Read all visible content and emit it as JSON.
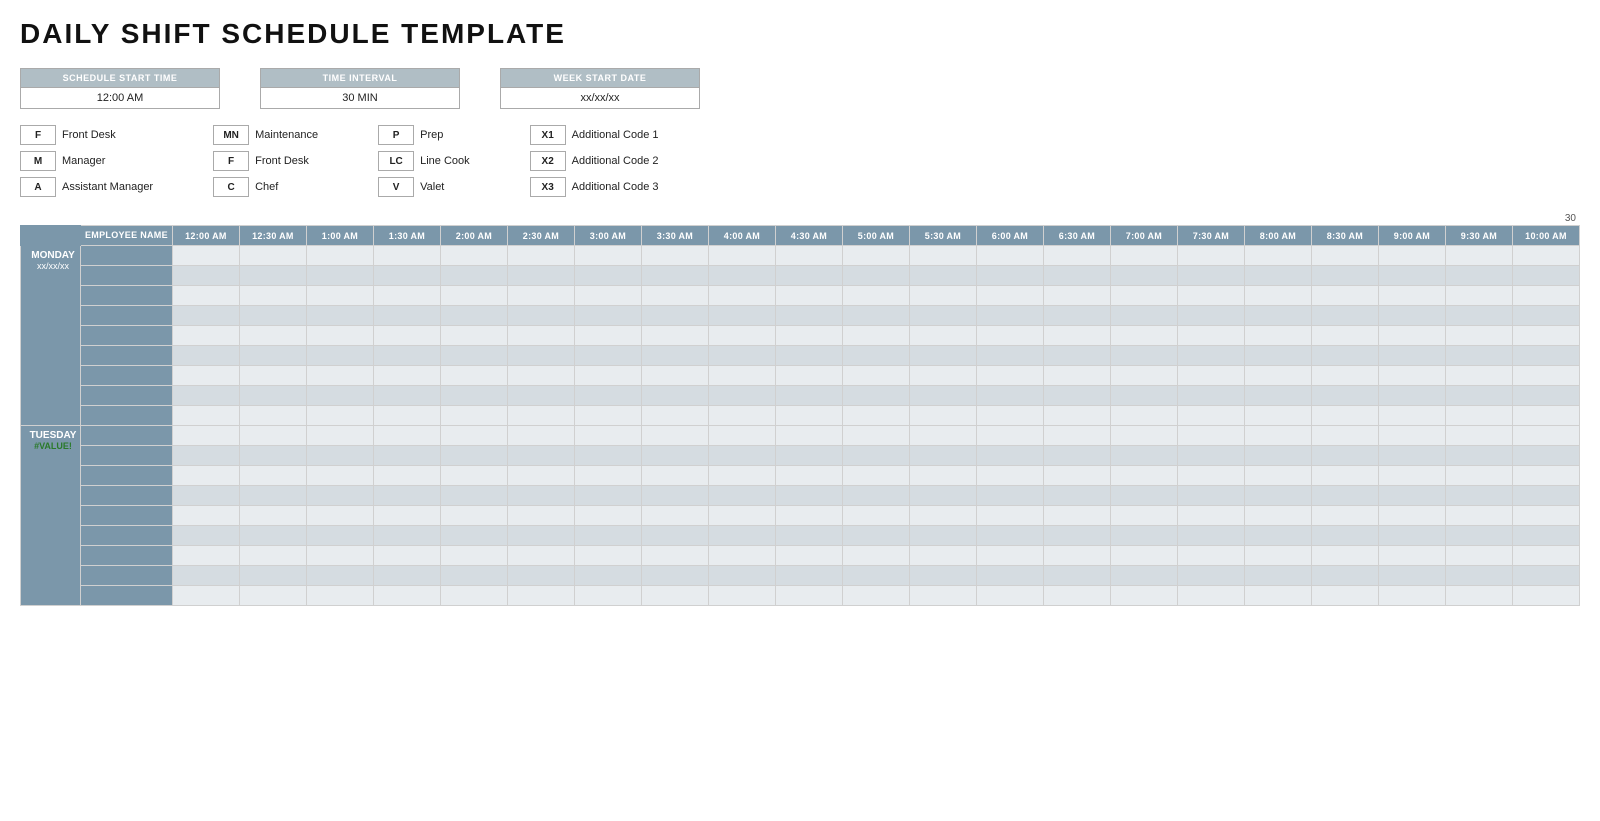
{
  "title": "DAILY SHIFT SCHEDULE TEMPLATE",
  "config": {
    "schedule_start_time_label": "SCHEDULE START TIME",
    "schedule_start_time_value": "12:00 AM",
    "time_interval_label": "TIME INTERVAL",
    "time_interval_value": "30 MIN",
    "week_start_date_label": "WEEK START DATE",
    "week_start_date_value": "xx/xx/xx"
  },
  "legend": [
    {
      "col": 1,
      "items": [
        {
          "code": "F",
          "name": "Front Desk"
        },
        {
          "code": "M",
          "name": "Manager"
        },
        {
          "code": "A",
          "name": "Assistant Manager"
        }
      ]
    },
    {
      "col": 2,
      "items": [
        {
          "code": "MN",
          "name": "Maintenance"
        },
        {
          "code": "F",
          "name": "Front Desk"
        },
        {
          "code": "C",
          "name": "Chef"
        }
      ]
    },
    {
      "col": 3,
      "items": [
        {
          "code": "P",
          "name": "Prep"
        },
        {
          "code": "LC",
          "name": "Line Cook"
        },
        {
          "code": "V",
          "name": "Valet"
        }
      ]
    },
    {
      "col": 4,
      "items": [
        {
          "code": "X1",
          "name": "Additional Code 1"
        },
        {
          "code": "X2",
          "name": "Additional Code 2"
        },
        {
          "code": "X3",
          "name": "Additional Code 3"
        }
      ]
    }
  ],
  "number_above": "30",
  "table": {
    "employee_name_label": "EMPLOYEE NAME",
    "time_slots": [
      "12:00 AM",
      "12:30 AM",
      "1:00 AM",
      "1:30 AM",
      "2:00 AM",
      "2:30 AM",
      "3:00 AM",
      "3:30 AM",
      "4:00 AM",
      "4:30 AM",
      "5:00 AM",
      "5:30 AM",
      "6:00 AM",
      "6:30 AM",
      "7:00 AM",
      "7:30 AM",
      "8:00 AM",
      "8:30 AM",
      "9:00 AM",
      "9:30 AM",
      "10:00 AM"
    ],
    "days": [
      {
        "name": "MONDAY",
        "date": "xx/xx/xx",
        "rows": 9
      },
      {
        "name": "TUESDAY",
        "date": "#VALUE!",
        "rows": 9
      }
    ]
  }
}
